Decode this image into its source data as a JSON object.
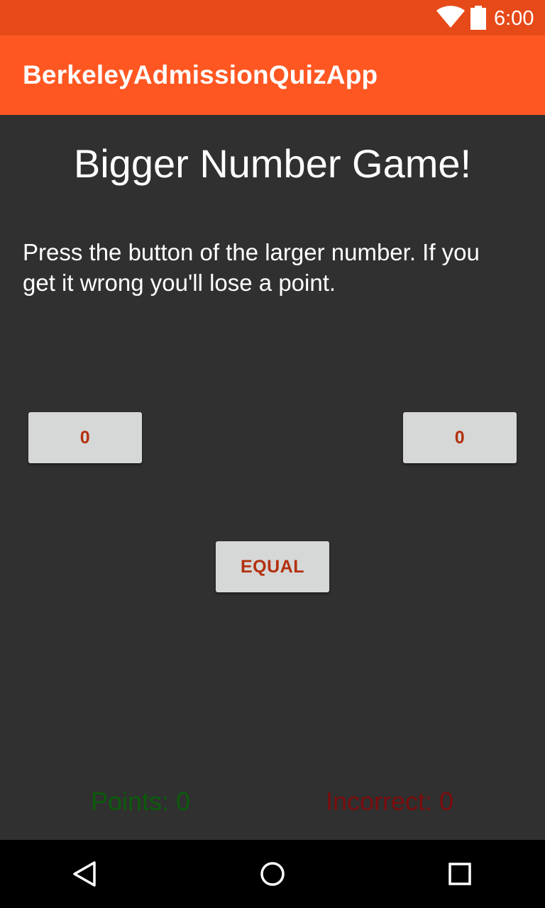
{
  "status_bar": {
    "time": "6:00",
    "icons": [
      "wifi-icon",
      "battery-icon"
    ]
  },
  "app_bar": {
    "title": "BerkeleyAdmissionQuizApp"
  },
  "game": {
    "title": "Bigger Number Game!",
    "instructions": "Press the button of the larger number. If you get it wrong you'll lose a point.",
    "left_button_label": "0",
    "right_button_label": "0",
    "equal_button_label": "EQUAL"
  },
  "score": {
    "points_label": "Points: 0",
    "incorrect_label": "Incorrect: 0"
  },
  "nav_bar": {
    "icons": [
      "back-icon",
      "home-icon",
      "recents-icon"
    ]
  },
  "colors": {
    "status_bar": "#E64A19",
    "app_bar": "#FF5722",
    "background": "#303030",
    "button_bg": "#D6D7D7",
    "button_text": "#B3300D",
    "points_text": "#0A5C0A",
    "incorrect_text": "#7A0C0C"
  }
}
